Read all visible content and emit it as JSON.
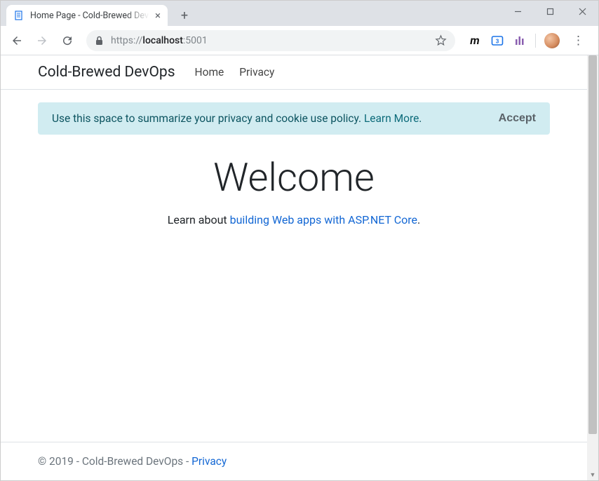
{
  "browser": {
    "tab_title": "Home Page - Cold-Brewed DevOps",
    "url_prefix": "https://",
    "url_host": "localhost",
    "url_port": ":5001"
  },
  "navbar": {
    "brand": "Cold-Brewed DevOps",
    "links": [
      "Home",
      "Privacy"
    ]
  },
  "alert": {
    "text": "Use this space to summarize your privacy and cookie use policy. ",
    "learn_more": "Learn More",
    "period": ".",
    "accept": "Accept"
  },
  "hero": {
    "title": "Welcome",
    "lead_prefix": "Learn about ",
    "lead_link": "building Web apps with ASP.NET Core",
    "lead_suffix": "."
  },
  "footer": {
    "text": "© 2019 - Cold-Brewed DevOps - ",
    "link": "Privacy"
  }
}
